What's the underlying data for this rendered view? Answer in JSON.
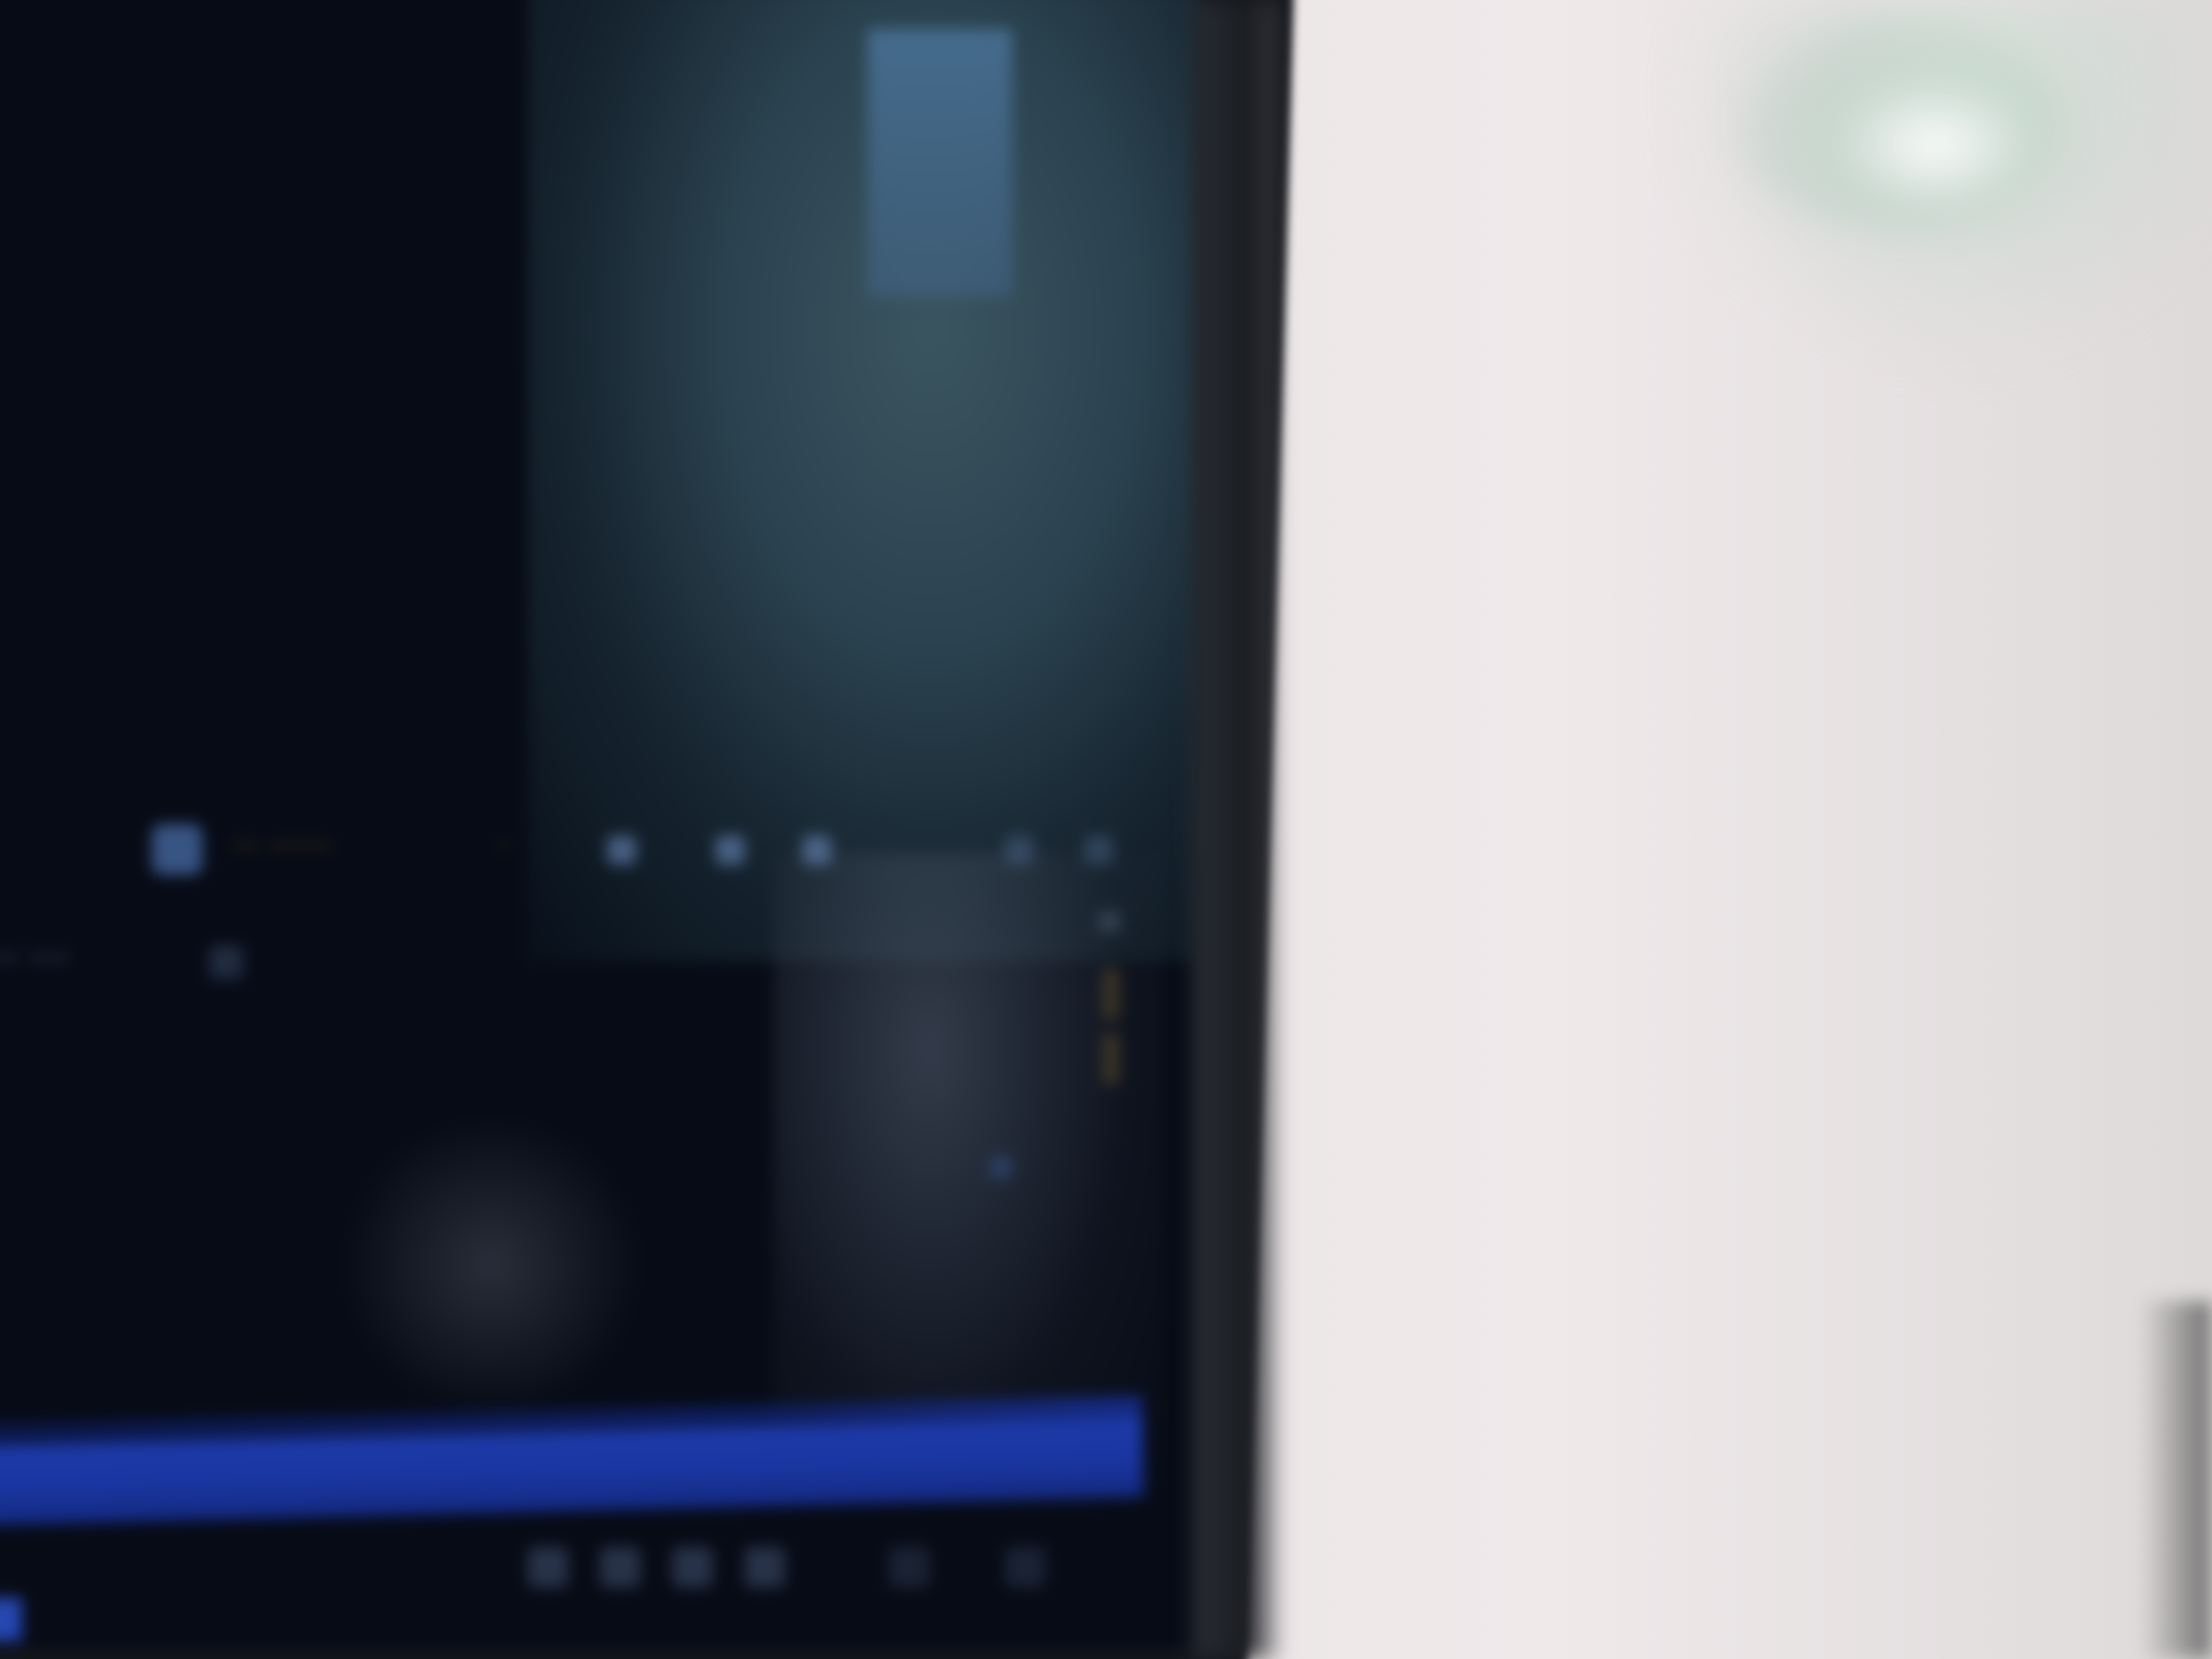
{
  "window": {
    "title": ""
  },
  "toolbar": {
    "text_a": "··· ·······",
    "text_b": "·"
  },
  "content": {
    "left_line": "···· ····"
  },
  "colors": {
    "screen_background": "#070b16",
    "panel": "#2b4350",
    "accent_orange": "#b8801a",
    "taskbar_blue": "#1a36a2",
    "wall": "#e9e4e5"
  },
  "icons": {
    "toolbar": [
      "app-icon",
      "square-icon",
      "square-icon",
      "square-icon",
      "square-icon"
    ],
    "taskbar": [
      "taskbar-icon",
      "taskbar-icon",
      "taskbar-icon",
      "taskbar-icon",
      "taskbar-icon",
      "taskbar-icon"
    ]
  }
}
